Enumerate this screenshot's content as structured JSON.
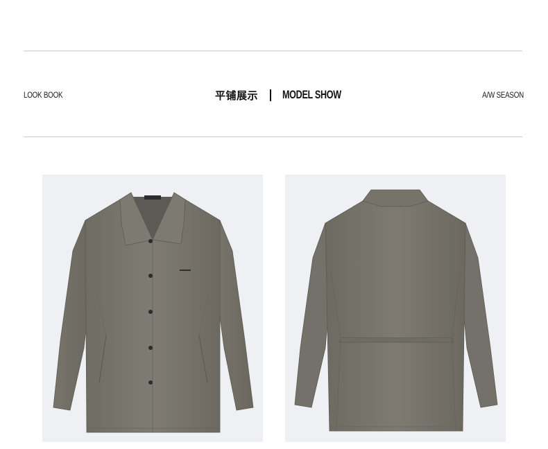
{
  "header": {
    "left_label": "LOOK BOOK",
    "title_cn": "平铺展示",
    "title_separator": "|",
    "title_en": "MODEL SHOW",
    "right_label": "A/W SEASON"
  },
  "images": [
    {
      "name": "jacket-front-flat-lay",
      "background": "#eef0f3",
      "garment_color": "#7b7870"
    },
    {
      "name": "jacket-back-flat-lay",
      "background": "#eef0f3",
      "garment_color": "#7b7870"
    }
  ],
  "colors": {
    "rule": "#c9c9c9",
    "text": "#111111"
  }
}
